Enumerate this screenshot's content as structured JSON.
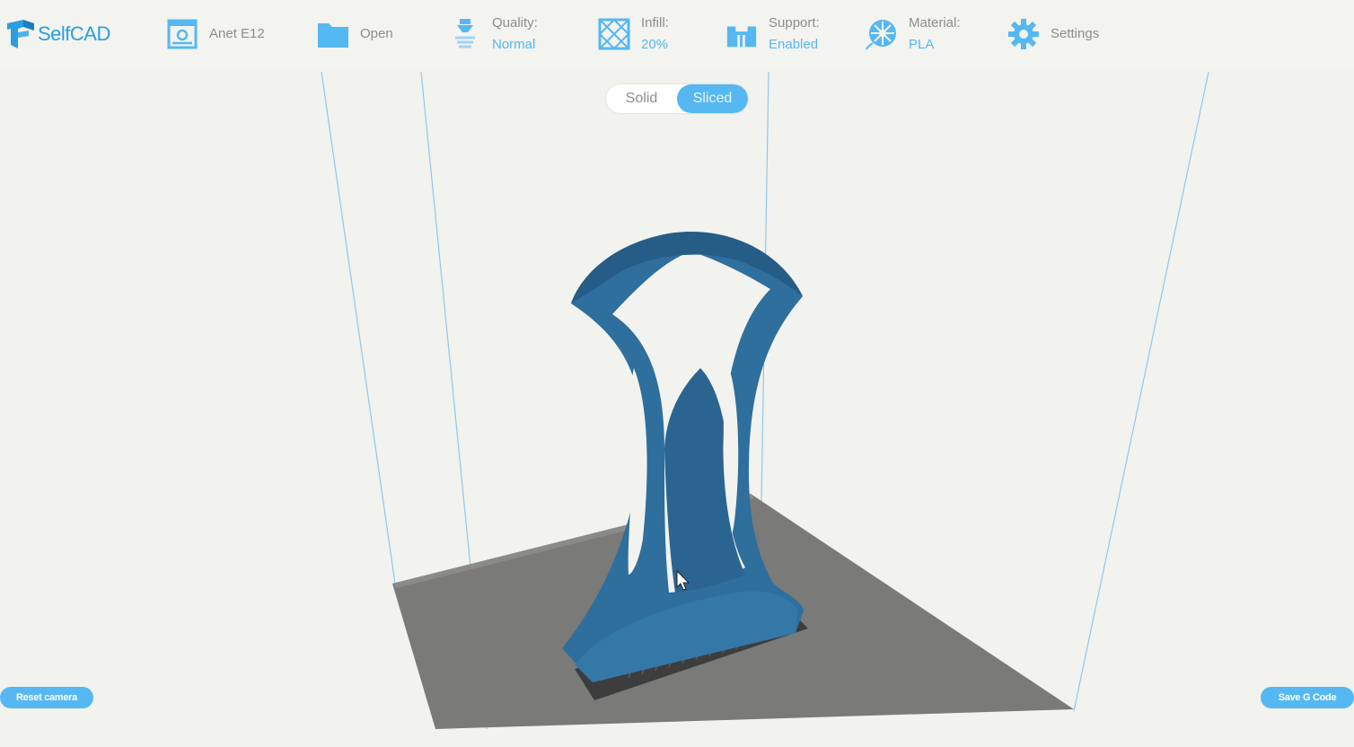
{
  "app": {
    "logo_text": "SelfCAD"
  },
  "toolbar": {
    "printer": {
      "label": "Anet E12"
    },
    "open": {
      "label": "Open"
    },
    "quality": {
      "label": "Quality:",
      "value": "Normal"
    },
    "infill": {
      "label": "Infill:",
      "value": "20%"
    },
    "support": {
      "label": "Support:",
      "value": "Enabled"
    },
    "material": {
      "label": "Material:",
      "value": "PLA"
    },
    "settings": {
      "label": "Settings"
    }
  },
  "view_toggle": {
    "solid": "Solid",
    "sliced": "Sliced",
    "selected": "Sliced"
  },
  "buttons": {
    "reset_camera": "Reset camera",
    "save_gcode": "Save G Code"
  },
  "colors": {
    "accent": "#55b8f2",
    "model": "#2e6f9e",
    "bed": "#7a7a78",
    "frame": "#8ec9ee"
  }
}
